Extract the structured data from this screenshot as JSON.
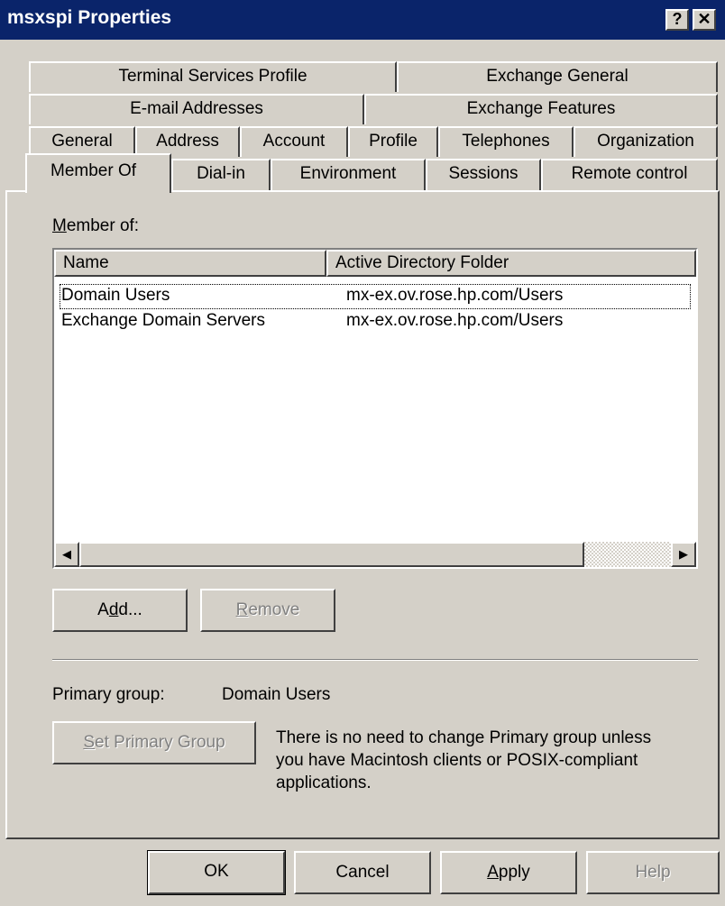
{
  "window": {
    "title": "msxspi Properties",
    "help_glyph": "?",
    "close_glyph": "✕"
  },
  "tabs": {
    "row1": [
      "Terminal Services Profile",
      "Exchange General"
    ],
    "row2": [
      "E-mail Addresses",
      "Exchange Features"
    ],
    "row3": [
      "General",
      "Address",
      "Account",
      "Profile",
      "Telephones",
      "Organization"
    ],
    "row4": [
      "Member Of",
      "Dial-in",
      "Environment",
      "Sessions",
      "Remote control"
    ],
    "active": "Member Of"
  },
  "member_of": {
    "label_first": "M",
    "label_rest": "ember of:",
    "columns": [
      "Name",
      "Active Directory Folder"
    ],
    "rows": [
      {
        "name": "Domain Users",
        "folder": "mx-ex.ov.rose.hp.com/Users",
        "focused": true
      },
      {
        "name": "Exchange Domain Servers",
        "folder": "mx-ex.ov.rose.hp.com/Users",
        "focused": false
      }
    ]
  },
  "buttons": {
    "add": {
      "pre": "A",
      "mnemonic": "d",
      "post": "d..."
    },
    "remove": {
      "pre": "",
      "mnemonic": "R",
      "post": "emove"
    },
    "set_primary": {
      "pre": "",
      "mnemonic": "S",
      "post": "et Primary Group"
    }
  },
  "primary_group": {
    "label": "Primary group:",
    "value": "Domain Users",
    "note_lines": [
      "There is no need to change Primary group unless",
      "you have Macintosh clients or POSIX-compliant",
      "applications."
    ]
  },
  "footer": {
    "ok": "OK",
    "cancel": "Cancel",
    "apply_mnemonic": "A",
    "apply_rest": "pply",
    "help": "Help"
  },
  "icons": {
    "scroll_left": "◀",
    "scroll_right": "▶"
  },
  "colors": {
    "titlebar": "#0a246a",
    "face": "#d4d0c8",
    "disabled_text": "#808080"
  }
}
